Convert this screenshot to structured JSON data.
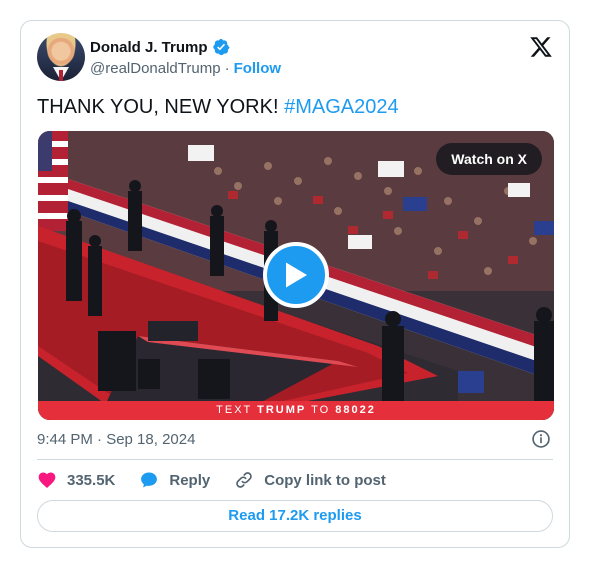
{
  "author": {
    "name": "Donald J. Trump",
    "handle": "@realDonaldTrump",
    "separator": "·",
    "follow_label": "Follow"
  },
  "tweet": {
    "text": "THANK YOU, NEW YORK! ",
    "hashtag": "#MAGA2024"
  },
  "media": {
    "watch_label": "Watch on X",
    "banner_prefix": "TEXT ",
    "banner_keyword": "TRUMP",
    "banner_middle": " TO ",
    "banner_number": "88022"
  },
  "timestamp": "9:44 PM · Sep 18, 2024",
  "actions": {
    "likes": "335.5K",
    "reply_label": "Reply",
    "copy_label": "Copy link to post"
  },
  "read_replies_label": "Read 17.2K replies",
  "colors": {
    "accent": "#1d9bf0",
    "like": "#f91880",
    "banner": "#e52f3a",
    "text": "#0f1419",
    "muted": "#536471"
  },
  "icons": [
    "verified-badge-icon",
    "x-logo-icon",
    "play-icon",
    "info-icon",
    "heart-icon",
    "reply-bubble-icon",
    "link-icon"
  ]
}
